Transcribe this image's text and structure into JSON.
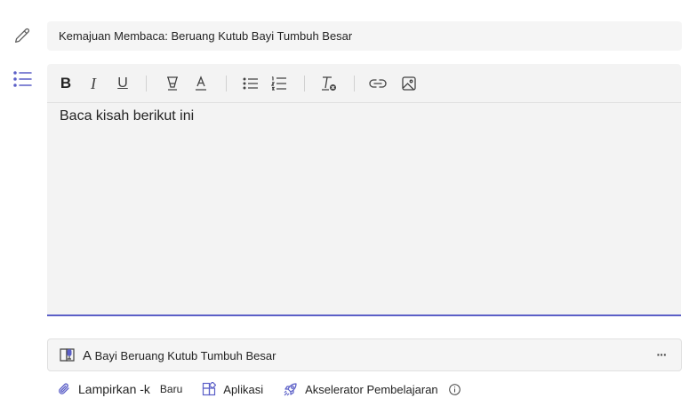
{
  "title_field": {
    "value": "Kemajuan Membaca: Beruang Kutub Bayi Tumbuh Besar"
  },
  "editor": {
    "body_text": "Baca kisah berikut ini",
    "accent_color": "#5b5fc7",
    "toolbar_icons": [
      "bold-icon",
      "italic-icon",
      "underline-icon",
      "highlight-icon",
      "font-color-icon",
      "bulleted-list-icon",
      "numbered-list-icon",
      "clear-formatting-icon",
      "link-icon",
      "image-icon"
    ],
    "bold_glyph": "B",
    "italic_glyph": "I",
    "underline_glyph": "U"
  },
  "attachment": {
    "prefix": "A",
    "name": "Bayi Beruang Kutub Tumbuh Besar",
    "more_label": "···"
  },
  "actions": {
    "attach_label": "Lampirkan -k",
    "new_label": "Baru",
    "apps_label": "Aplikasi",
    "accelerator_label": "Akselerator Pembelajaran"
  }
}
